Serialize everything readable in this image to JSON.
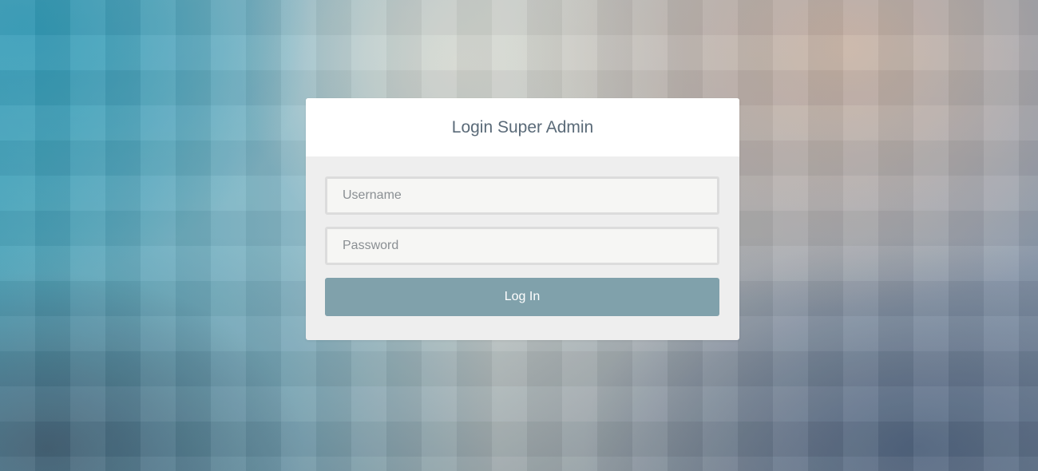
{
  "login": {
    "title": "Login Super Admin",
    "username_placeholder": "Username",
    "password_placeholder": "Password",
    "submit_label": "Log In"
  },
  "colors": {
    "button_bg": "#80a1ab",
    "card_body_bg": "#eeeeee",
    "header_bg": "#ffffff",
    "title_color": "#5a6a78"
  }
}
